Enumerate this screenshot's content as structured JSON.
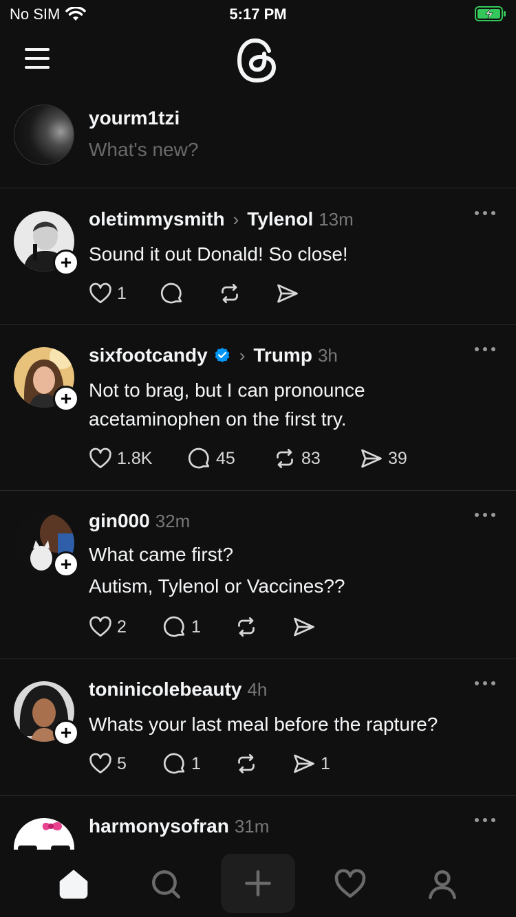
{
  "status_bar": {
    "carrier": "No SIM",
    "time": "5:17 PM"
  },
  "composer": {
    "username": "yourm1tzi",
    "placeholder": "What's new?"
  },
  "posts": [
    {
      "username": "oletimmysmith",
      "topic": "Tylenol",
      "time": "13m",
      "text": "Sound it out Donald! So close!",
      "likes": "1",
      "replies": "",
      "reposts": "",
      "shares": ""
    },
    {
      "username": "sixfootcandy",
      "verified": true,
      "topic": "Trump",
      "time": "3h",
      "text": "Not to brag, but I can pronounce acetaminophen on the first try.",
      "likes": "1.8K",
      "replies": "45",
      "reposts": "83",
      "shares": "39"
    },
    {
      "username": "gin000",
      "topic": "",
      "time": "32m",
      "text_lines": [
        "What came first?",
        "Autism, Tylenol or Vaccines??"
      ],
      "likes": "2",
      "replies": "1",
      "reposts": "",
      "shares": ""
    },
    {
      "username": "toninicolebeauty",
      "topic": "",
      "time": "4h",
      "text": "Whats your last meal before the rapture?",
      "likes": "5",
      "replies": "1",
      "reposts": "",
      "shares": "1"
    },
    {
      "username": "harmonysofran",
      "topic": "",
      "time": "31m"
    }
  ],
  "colors": {
    "background": "#101010",
    "text": "#f3f5f7",
    "muted": "#777777",
    "verified": "#0095f6",
    "battery": "#34c759"
  },
  "tab_bar": [
    "home-icon",
    "search-icon",
    "create-icon",
    "activity-heart-icon",
    "profile-icon"
  ]
}
